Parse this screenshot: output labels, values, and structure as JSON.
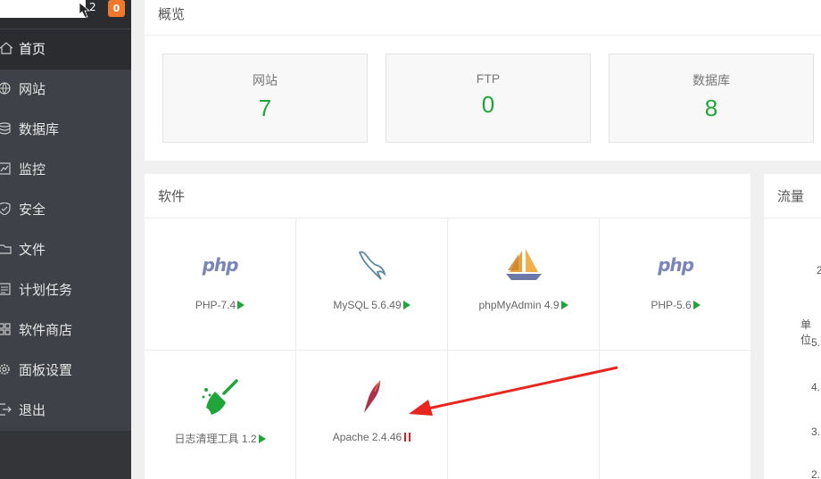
{
  "sidebar": {
    "header_number": "2",
    "badge": "0",
    "items": [
      {
        "label": "首页",
        "icon": "home-icon"
      },
      {
        "label": "网站",
        "icon": "globe-icon"
      },
      {
        "label": "数据库",
        "icon": "database-icon"
      },
      {
        "label": "监控",
        "icon": "monitor-icon"
      },
      {
        "label": "安全",
        "icon": "shield-icon"
      },
      {
        "label": "文件",
        "icon": "folder-icon"
      },
      {
        "label": "计划任务",
        "icon": "list-icon"
      },
      {
        "label": "软件商店",
        "icon": "grid-icon"
      },
      {
        "label": "面板设置",
        "icon": "gear-icon"
      },
      {
        "label": "退出",
        "icon": "logout-icon"
      }
    ]
  },
  "overview": {
    "title": "概览",
    "stats": [
      {
        "label": "网站",
        "value": "7"
      },
      {
        "label": "FTP",
        "value": "0"
      },
      {
        "label": "数据库",
        "value": "8"
      }
    ]
  },
  "software": {
    "title": "软件",
    "items": [
      {
        "name": "PHP-7.4",
        "status": "running"
      },
      {
        "name": "MySQL 5.6.49",
        "status": "running"
      },
      {
        "name": "phpMyAdmin 4.9",
        "status": "running"
      },
      {
        "name": "PHP-5.6",
        "status": "running"
      },
      {
        "name": "日志清理工具 1.2",
        "status": "running"
      },
      {
        "name": "Apache 2.4.46",
        "status": "stopped"
      }
    ],
    "php_logo_text": "php"
  },
  "traffic": {
    "title": "流量",
    "fragments": [
      "2",
      "单位",
      "5.",
      "4.",
      "3.",
      "2."
    ]
  },
  "colors": {
    "accent_green": "#20a53a",
    "badge_orange": "#f0782d",
    "arrow_red": "#e8261f"
  }
}
